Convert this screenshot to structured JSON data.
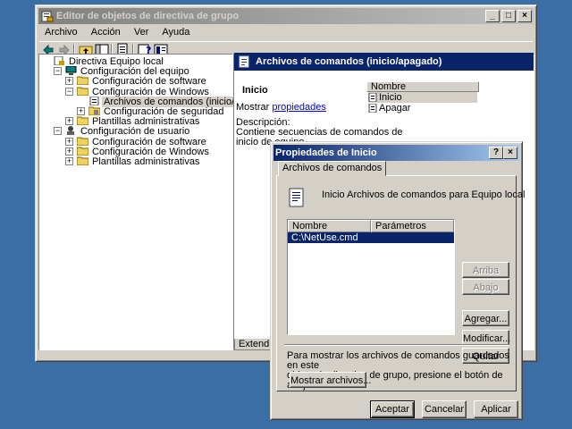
{
  "main_window": {
    "title": "Editor de objetos de directiva de grupo",
    "menu": [
      "Archivo",
      "Acción",
      "Ver",
      "Ayuda"
    ],
    "status_tab": "Extendido"
  },
  "tree": [
    {
      "label": "Directiva Equipo local",
      "level": 0,
      "expander": "",
      "icon": "policy"
    },
    {
      "label": "Configuración del equipo",
      "level": 1,
      "expander": "−",
      "icon": "computer"
    },
    {
      "label": "Configuración de software",
      "level": 2,
      "expander": "+",
      "icon": "folder"
    },
    {
      "label": "Configuración de Windows",
      "level": 2,
      "expander": "−",
      "icon": "folder"
    },
    {
      "label": "Archivos de comandos (inicio/apagado)",
      "level": 3,
      "expander": "",
      "icon": "script",
      "selected": true
    },
    {
      "label": "Configuración de seguridad",
      "level": 3,
      "expander": "+",
      "icon": "security"
    },
    {
      "label": "Plantillas administrativas",
      "level": 2,
      "expander": "+",
      "icon": "folder"
    },
    {
      "label": "Configuración de usuario",
      "level": 1,
      "expander": "−",
      "icon": "user"
    },
    {
      "label": "Configuración de software",
      "level": 2,
      "expander": "+",
      "icon": "folder"
    },
    {
      "label": "Configuración de Windows",
      "level": 2,
      "expander": "+",
      "icon": "folder"
    },
    {
      "label": "Plantillas administrativas",
      "level": 2,
      "expander": "+",
      "icon": "folder"
    }
  ],
  "detail": {
    "header": "Archivos de comandos (inicio/apagado)",
    "item_title": "Inicio",
    "show_prefix": "Mostrar",
    "show_link": "propiedades",
    "desc_label": "Descripción:",
    "desc_line1": "Contiene secuencias de comandos de",
    "desc_line2": "inicio de equipo.",
    "list_header": "Nombre",
    "list_items": [
      "Inicio",
      "Apagar"
    ]
  },
  "dialog": {
    "title": "Propiedades de Inicio",
    "tab": "Archivos de comandos",
    "heading": "Inicio Archivos de comandos para Equipo local",
    "columns": [
      "Nombre",
      "Parámetros"
    ],
    "rows": [
      {
        "name": "C:\\NetUse.cmd",
        "params": ""
      }
    ],
    "buttons": {
      "up": "Arriba",
      "down": "Abajo",
      "add": "Agregar...",
      "edit": "Modificar...",
      "remove": "Quitar",
      "show_files": "Mostrar archivos...",
      "ok": "Aceptar",
      "cancel": "Cancelar",
      "apply": "Aplicar"
    },
    "info_line1": "Para mostrar los archivos de comandos guardados en este",
    "info_line2": "objeto de directiva de grupo, presione el botón de abajo."
  }
}
